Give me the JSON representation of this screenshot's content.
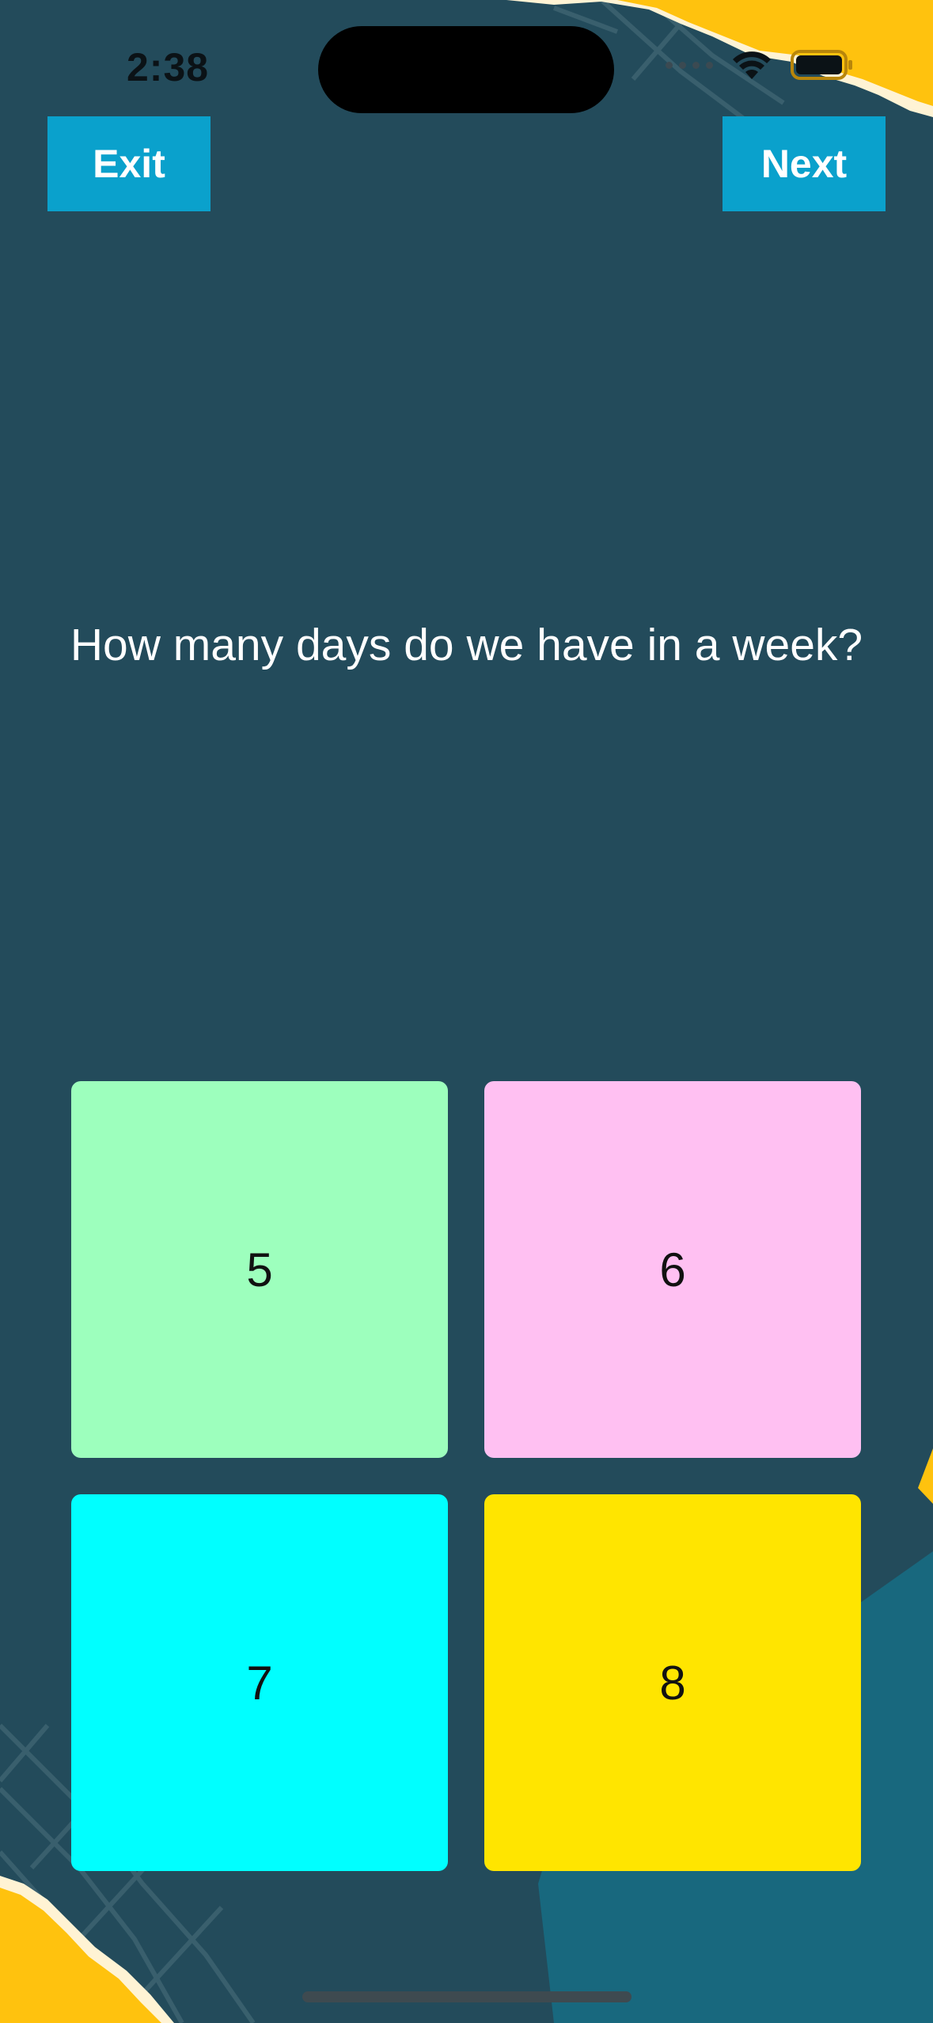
{
  "status_bar": {
    "time": "2:38"
  },
  "toolbar": {
    "exit_label": "Exit",
    "next_label": "Next"
  },
  "quiz": {
    "question": "How many days do we have in a week?",
    "answers": [
      {
        "label": "5",
        "color": "#9dffbd"
      },
      {
        "label": "6",
        "color": "#ffc0f2"
      },
      {
        "label": "7",
        "color": "#00ffff"
      },
      {
        "label": "8",
        "color": "#ffe500"
      }
    ]
  },
  "theme": {
    "background": "#234b5b",
    "button_color": "#0aa1cc",
    "accent_paper": "#ffc20e"
  }
}
